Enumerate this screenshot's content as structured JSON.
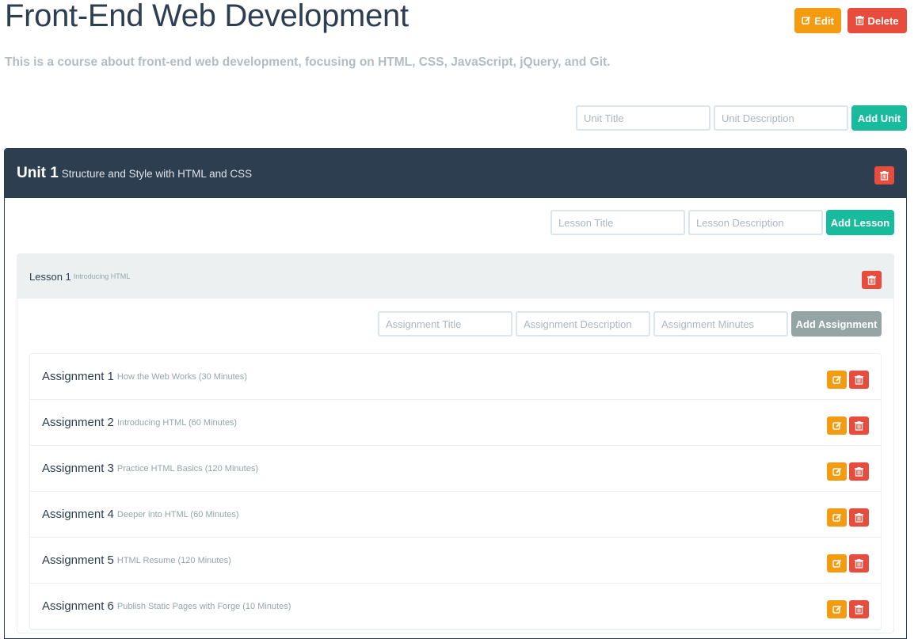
{
  "course": {
    "title": "Front-End Web Development",
    "description": "This is a course about front-end web development, focusing on HTML, CSS, JavaScript, jQuery, and Git.",
    "edit_label": "Edit",
    "delete_label": "Delete"
  },
  "unit_form": {
    "title_placeholder": "Unit Title",
    "description_placeholder": "Unit Description",
    "add_label": "Add Unit"
  },
  "unit": {
    "name": "Unit 1",
    "subtitle": "Structure and Style with HTML and CSS"
  },
  "lesson_form": {
    "title_placeholder": "Lesson Title",
    "description_placeholder": "Lesson Description",
    "add_label": "Add Lesson"
  },
  "lesson": {
    "name": "Lesson 1",
    "subtitle": "Introducing HTML"
  },
  "assignment_form": {
    "title_placeholder": "Assignment Title",
    "description_placeholder": "Assignment Description",
    "minutes_placeholder": "Assignment Minutes",
    "add_label": "Add Assignment"
  },
  "assignments": [
    {
      "name": "Assignment 1",
      "subtitle": "How the Web Works (30 Minutes)"
    },
    {
      "name": "Assignment 2",
      "subtitle": "Introducing HTML (60 Minutes)"
    },
    {
      "name": "Assignment 3",
      "subtitle": "Practice HTML Basics (120 Minutes)"
    },
    {
      "name": "Assignment 4",
      "subtitle": "Deeper into HTML (60 Minutes)"
    },
    {
      "name": "Assignment 5",
      "subtitle": "HTML Resume (120 Minutes)"
    },
    {
      "name": "Assignment 6",
      "subtitle": "Publish Static Pages with Forge (10 Minutes)"
    }
  ],
  "colors": {
    "primary": "#2c3e50",
    "warning": "#f39c12",
    "danger": "#e74c3c",
    "success": "#18bc9c",
    "muted": "#95a5a6"
  },
  "icons": {
    "edit": "edit-icon",
    "delete": "trash-icon"
  }
}
